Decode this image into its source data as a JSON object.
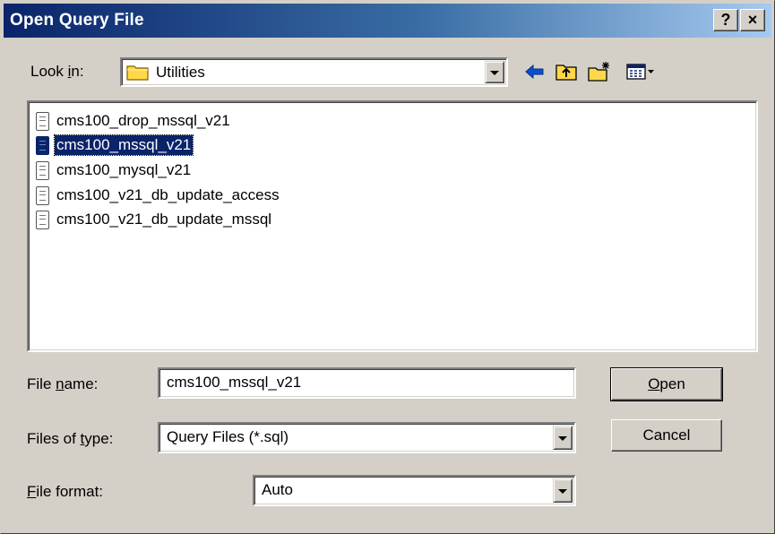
{
  "window": {
    "title": "Open Query File",
    "help_label": "?",
    "close_label": "×"
  },
  "toolbar": {
    "look_in_label_pre": "Look ",
    "look_in_label_key": "i",
    "look_in_label_post": "n:",
    "look_in_value": "Utilities",
    "icons": [
      "back-icon",
      "up-folder-icon",
      "new-folder-icon",
      "view-menu-icon"
    ]
  },
  "files": [
    {
      "name": "cms100_drop_mssql_v21",
      "selected": false
    },
    {
      "name": "cms100_mssql_v21",
      "selected": true
    },
    {
      "name": "cms100_mysql_v21",
      "selected": false
    },
    {
      "name": "cms100_v21_db_update_access",
      "selected": false
    },
    {
      "name": "cms100_v21_db_update_mssql",
      "selected": false
    }
  ],
  "form": {
    "file_name_label_pre": "File ",
    "file_name_label_key": "n",
    "file_name_label_post": "ame:",
    "file_name_value": "cms100_mssql_v21",
    "files_of_type_label_pre": "Files of ",
    "files_of_type_label_key": "t",
    "files_of_type_label_post": "ype:",
    "files_of_type_value": "Query Files (*.sql)",
    "file_format_label_key": "F",
    "file_format_label_post": "ile format:",
    "file_format_value": "Auto"
  },
  "buttons": {
    "open_key": "O",
    "open_post": "pen",
    "cancel": "Cancel"
  },
  "colors": {
    "title_start": "#0a246a",
    "title_end": "#a6caf0",
    "selection": "#0a246a",
    "face": "#d4d0c8"
  }
}
